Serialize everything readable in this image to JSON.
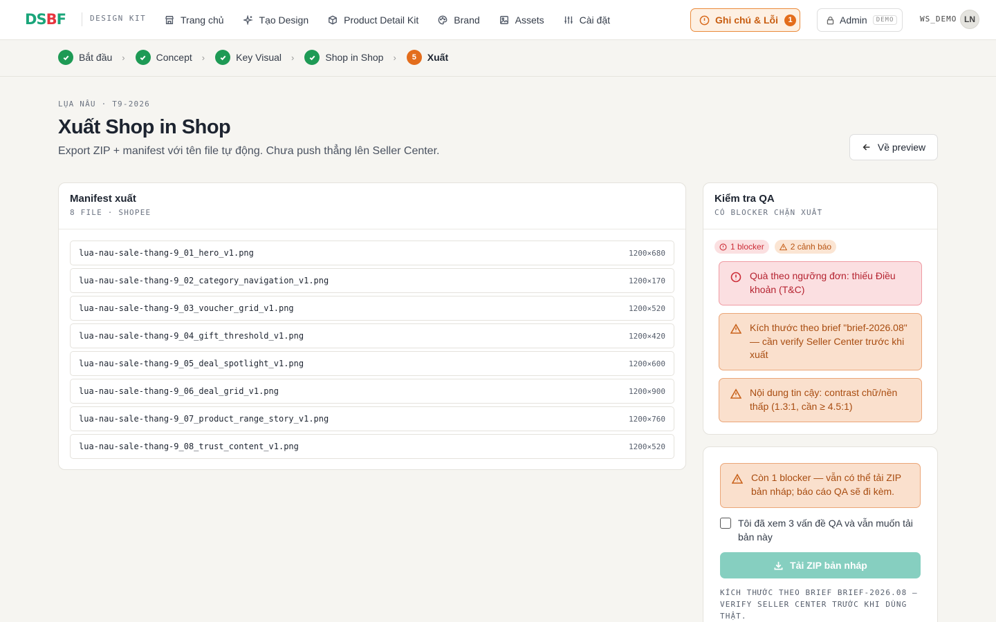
{
  "brand": {
    "logo": "DSBF",
    "kit_label": "DESIGN KIT"
  },
  "nav": [
    {
      "label": "Trang chủ",
      "icon": "store-icon"
    },
    {
      "label": "Tạo Design",
      "icon": "sparkle-icon"
    },
    {
      "label": "Product Detail Kit",
      "icon": "box-icon"
    },
    {
      "label": "Brand",
      "icon": "palette-icon"
    },
    {
      "label": "Assets",
      "icon": "image-icon"
    },
    {
      "label": "Cài đặt",
      "icon": "sliders-icon"
    }
  ],
  "header": {
    "notes_label": "Ghi chú & Lỗi",
    "notes_count": "1",
    "admin_label": "Admin",
    "demo_tag": "DEMO",
    "workspace": "WS_DEMO",
    "avatar_initials": "LN"
  },
  "steps": [
    {
      "label": "Bắt đầu",
      "state": "done"
    },
    {
      "label": "Concept",
      "state": "done"
    },
    {
      "label": "Key Visual",
      "state": "done"
    },
    {
      "label": "Shop in Shop",
      "state": "done"
    },
    {
      "label": "Xuất",
      "state": "current",
      "number": "5"
    }
  ],
  "page": {
    "eyebrow": "LỤA NÂU · T9-2026",
    "title": "Xuất Shop in Shop",
    "subtitle": "Export ZIP + manifest với tên file tự động. Chưa push thẳng lên Seller Center.",
    "back_label": "Về preview"
  },
  "manifest": {
    "title": "Manifest xuất",
    "sub": "8 FILE · SHOPEE",
    "files": [
      {
        "name": "lua-nau-sale-thang-9_01_hero_v1.png",
        "dim": "1200×680"
      },
      {
        "name": "lua-nau-sale-thang-9_02_category_navigation_v1.png",
        "dim": "1200×170"
      },
      {
        "name": "lua-nau-sale-thang-9_03_voucher_grid_v1.png",
        "dim": "1200×520"
      },
      {
        "name": "lua-nau-sale-thang-9_04_gift_threshold_v1.png",
        "dim": "1200×420"
      },
      {
        "name": "lua-nau-sale-thang-9_05_deal_spotlight_v1.png",
        "dim": "1200×600"
      },
      {
        "name": "lua-nau-sale-thang-9_06_deal_grid_v1.png",
        "dim": "1200×900"
      },
      {
        "name": "lua-nau-sale-thang-9_07_product_range_story_v1.png",
        "dim": "1200×760"
      },
      {
        "name": "lua-nau-sale-thang-9_08_trust_content_v1.png",
        "dim": "1200×520"
      }
    ]
  },
  "qa": {
    "title": "Kiểm tra QA",
    "sub": "CÓ BLOCKER CHẶN XUẤT",
    "blocker_badge": "1 blocker",
    "warning_badge": "2 cảnh báo",
    "alerts": [
      {
        "level": "blocker",
        "text": "Quà theo ngưỡng đơn: thiếu Điều khoản (T&C)"
      },
      {
        "level": "warning",
        "text": "Kích thước theo brief \"brief-2026.08\" — cần verify Seller Center trước khi xuất"
      },
      {
        "level": "warning",
        "text": "Nội dung tin cậy: contrast chữ/nền thấp (1.3:1, cần ≥ 4.5:1)"
      }
    ]
  },
  "export": {
    "warning": "Còn 1 blocker — vẫn có thể tải ZIP bản nháp; báo cáo QA sẽ đi kèm.",
    "confirm_label": "Tôi đã xem 3 vấn đề QA và vẫn muốn tải bản này",
    "confirm_checked": false,
    "button_label": "Tải ZIP bản nháp",
    "footnote": "KÍCH THƯỚC THEO BRIEF BRIEF-2026.08 — VERIFY SELLER CENTER TRƯỚC KHI DÙNG THẬT."
  },
  "colors": {
    "brand_green": "#1e9a55",
    "accent_orange": "#e36d1c",
    "blocker_red": "#cc2b36",
    "zip_teal": "#86cfc0"
  }
}
